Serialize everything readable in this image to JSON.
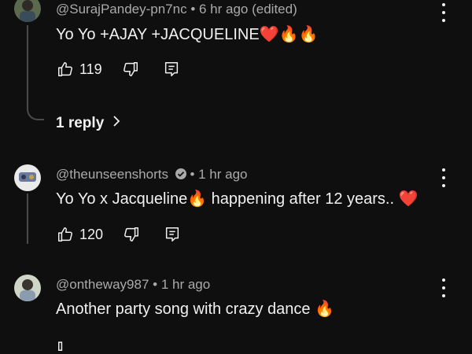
{
  "comments": [
    {
      "handle": "@SurajPandey-pn7nc",
      "time": "• 6 hr ago (edited)",
      "text": "Yo Yo +AJAY +JACQUELINE❤️🔥🔥",
      "likes": "119",
      "replies_label": "1 reply"
    },
    {
      "handle": "@theunseenshorts",
      "time": "• 1 hr ago",
      "text": "Yo Yo x Jacqueline🔥 happening after 12 years.. ❤️",
      "likes": "120"
    },
    {
      "handle": "@ontheway987",
      "time": "• 1 hr ago",
      "text": "Another party song with crazy dance 🔥"
    }
  ],
  "icons": {
    "like": "thumbs-up-icon",
    "dislike": "thumbs-down-icon",
    "reply": "reply-comment-icon",
    "menu": "more-vertical-icon",
    "chevron": "chevron-right-icon"
  },
  "colors": {
    "background": "#0f0f0f",
    "text": "#f1f1f1",
    "meta": "#aaaaaa"
  }
}
